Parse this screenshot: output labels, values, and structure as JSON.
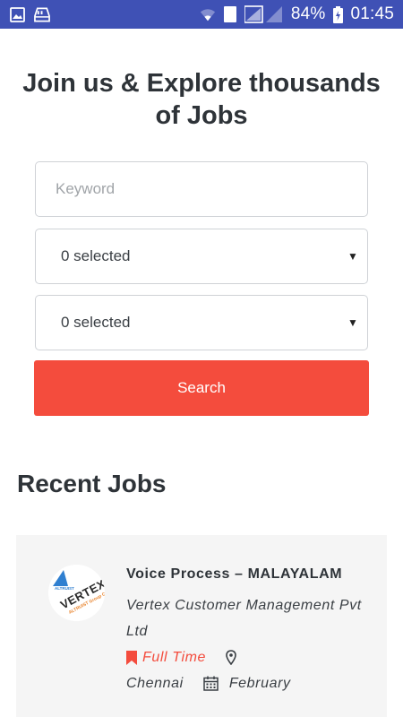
{
  "status_bar": {
    "battery": "84%",
    "time": "01:45",
    "sim_label": "1",
    "icons": [
      "image-icon",
      "storage-icon",
      "wifi-icon",
      "sim-icon",
      "signal-icon",
      "battery-charging-icon"
    ]
  },
  "hero": {
    "title": "Join us & Explore thousands of Jobs"
  },
  "search_form": {
    "keyword_placeholder": "Keyword",
    "select_1_value": "0 selected",
    "select_2_value": "0 selected",
    "search_label": "Search"
  },
  "recent_jobs": {
    "heading": "Recent Jobs",
    "jobs": [
      {
        "title": "Voice Process – MALAYALAM",
        "company": "Vertex Customer Management Pvt Ltd",
        "type": "Full Time",
        "location": "Chennai",
        "date": "February",
        "logo_text": "VERTEX",
        "logo_subtext": "ALTRUIST Group Co."
      }
    ]
  },
  "colors": {
    "status_bar": "#3f51b5",
    "accent": "#f44c3d",
    "card_bg": "#f5f5f5",
    "text_dark": "#2e3338"
  }
}
